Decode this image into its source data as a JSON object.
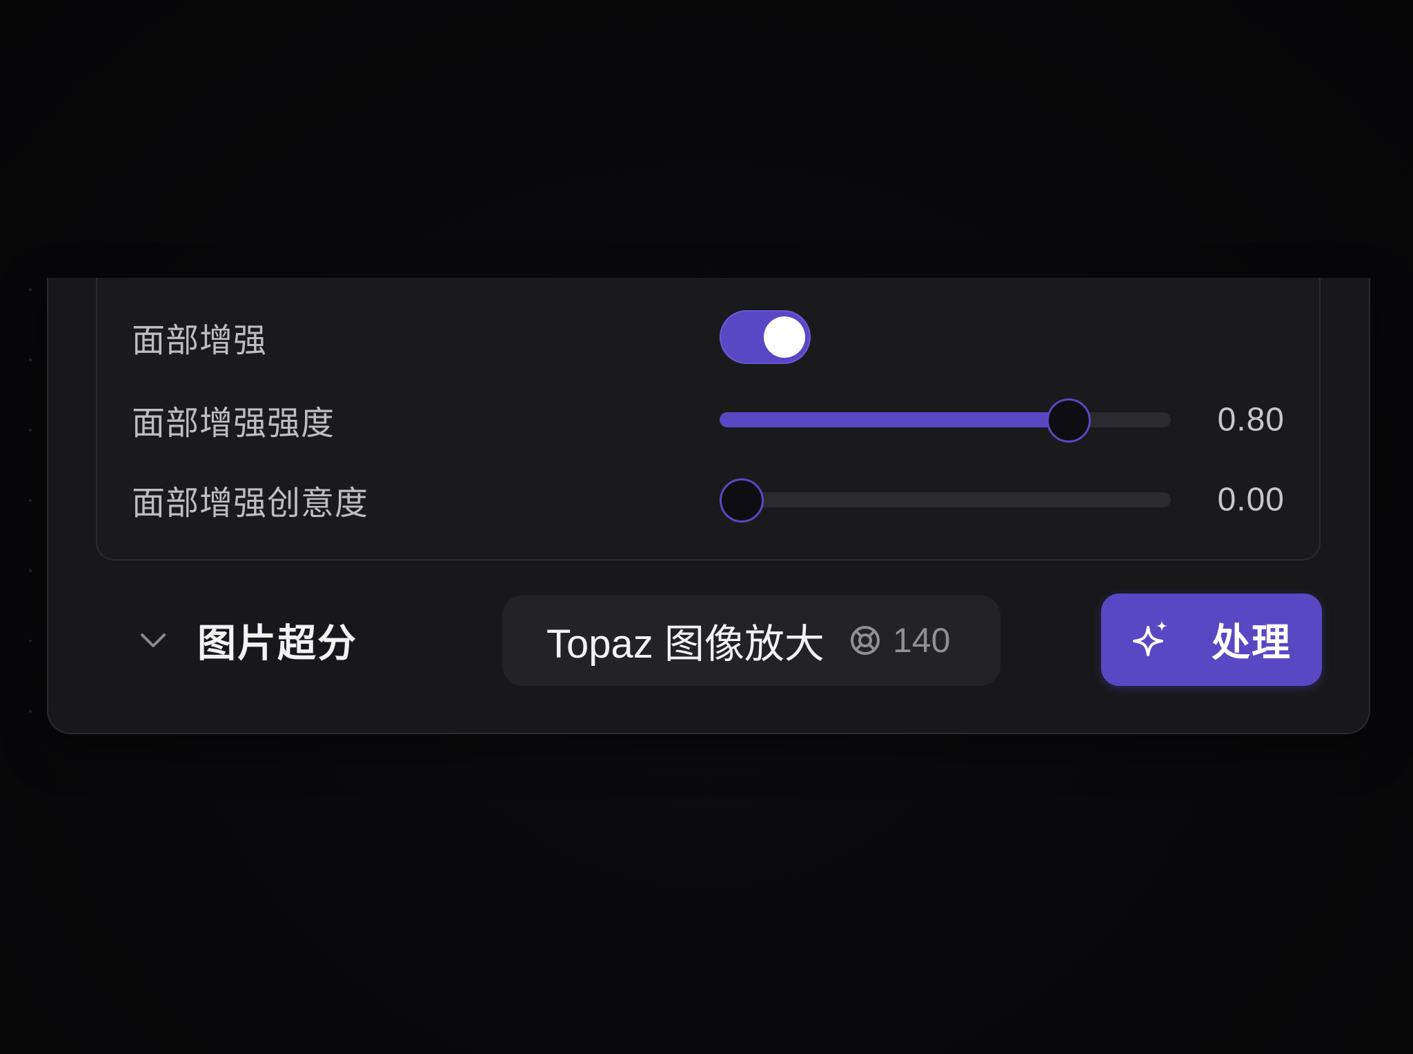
{
  "face_enhance": {
    "toggle_label": "面部增强",
    "toggle_on": true,
    "strength_label": "面部增强强度",
    "strength_value": 0.8,
    "strength_display": "0.80",
    "creativity_label": "面部增强创意度",
    "creativity_value": 0.0,
    "creativity_display": "0.00"
  },
  "upscale": {
    "section_title": "图片超分",
    "chevron_icon": "chevron-down-icon",
    "model_name": "Topaz 图像放大",
    "credit_icon": "credit-coin-icon",
    "credit_cost": "140",
    "process_icon": "sparkle-icon",
    "process_label": "处理"
  },
  "colors": {
    "accent": "#5a47c4",
    "panel": "#18181a",
    "background": "#070709"
  }
}
